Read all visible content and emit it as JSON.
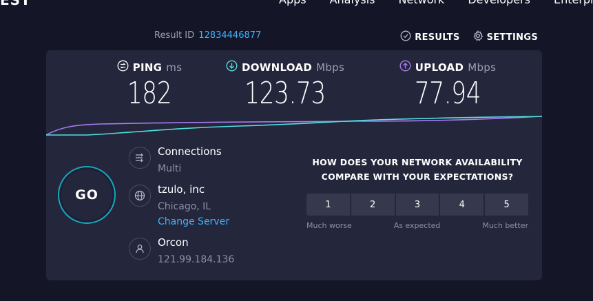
{
  "nav": {
    "logo": "EST",
    "items": [
      "Apps",
      "Analysis",
      "Network",
      "Developers",
      "Enterprise"
    ]
  },
  "result": {
    "label": "Result ID",
    "id": "12834446877"
  },
  "actions": {
    "results": "RESULTS",
    "settings": "SETTINGS"
  },
  "metrics": {
    "ping": {
      "label": "PING",
      "unit": "ms",
      "value": "182"
    },
    "download": {
      "label": "DOWNLOAD",
      "unit": "Mbps",
      "value": "123.73"
    },
    "upload": {
      "label": "UPLOAD",
      "unit": "Mbps",
      "value": "77.94"
    }
  },
  "go_label": "GO",
  "connections": {
    "title": "Connections",
    "value": "Multi"
  },
  "isp": {
    "name": "tzulo, inc",
    "location": "Chicago, IL",
    "change": "Change Server"
  },
  "host": {
    "name": "Orcon",
    "ip": "121.99.184.136"
  },
  "survey": {
    "question_line1": "HOW DOES YOUR NETWORK AVAILABILITY",
    "question_line2": "COMPARE WITH YOUR EXPECTATIONS?",
    "options": [
      "1",
      "2",
      "3",
      "4",
      "5"
    ],
    "label_low": "Much worse",
    "label_mid": "As expected",
    "label_high": "Much better"
  },
  "colors": {
    "download": "#52dfe0",
    "upload": "#a77bf0",
    "link": "#3db5ff",
    "go_ring": "#16a6bf"
  }
}
